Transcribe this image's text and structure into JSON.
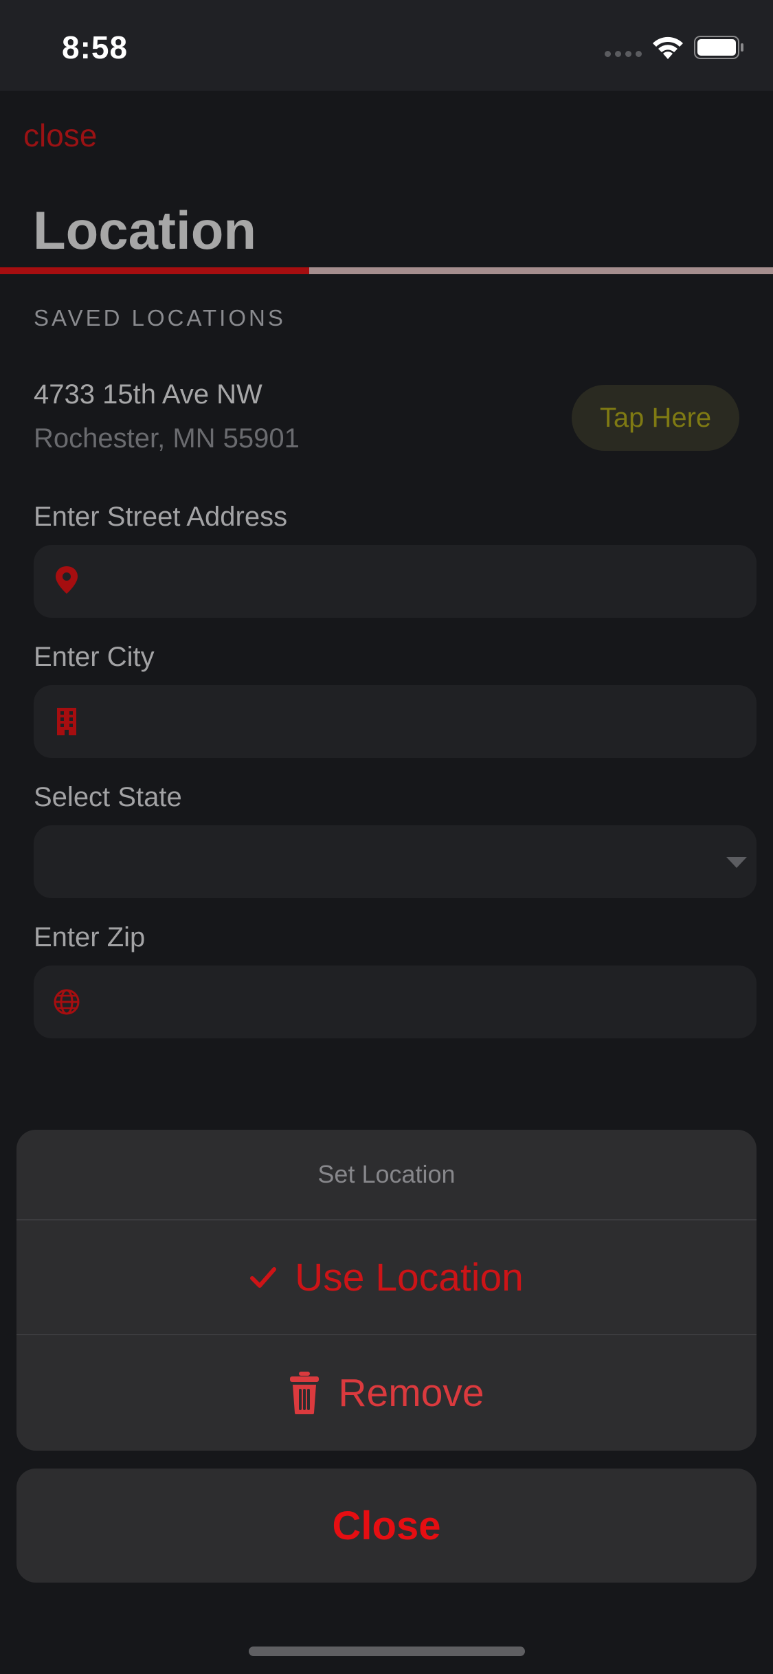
{
  "status_bar": {
    "time": "8:58"
  },
  "header": {
    "close_label": "close",
    "title": "Location",
    "progress": 0.4
  },
  "saved_locations": {
    "label": "SAVED LOCATIONS",
    "items": [
      {
        "line1": "4733 15th Ave NW",
        "line2": "Rochester, MN 55901",
        "action_label": "Tap Here"
      }
    ]
  },
  "form": {
    "street": {
      "label": "Enter Street Address",
      "value": "",
      "icon": "map-pin-icon"
    },
    "city": {
      "label": "Enter City",
      "value": "",
      "icon": "building-icon"
    },
    "state": {
      "label": "Select State",
      "value": "",
      "icon": "chevron-down-icon"
    },
    "zip": {
      "label": "Enter Zip",
      "value": "",
      "icon": "globe-icon"
    }
  },
  "action_sheet": {
    "title": "Set Location",
    "use_label": "Use Location",
    "remove_label": "Remove",
    "close_label": "Close"
  },
  "colors": {
    "accent": "#a60e10",
    "background": "#16171a",
    "field": "#202124",
    "sheet": "#2d2d2f",
    "tap_here": "#7f7a13"
  }
}
